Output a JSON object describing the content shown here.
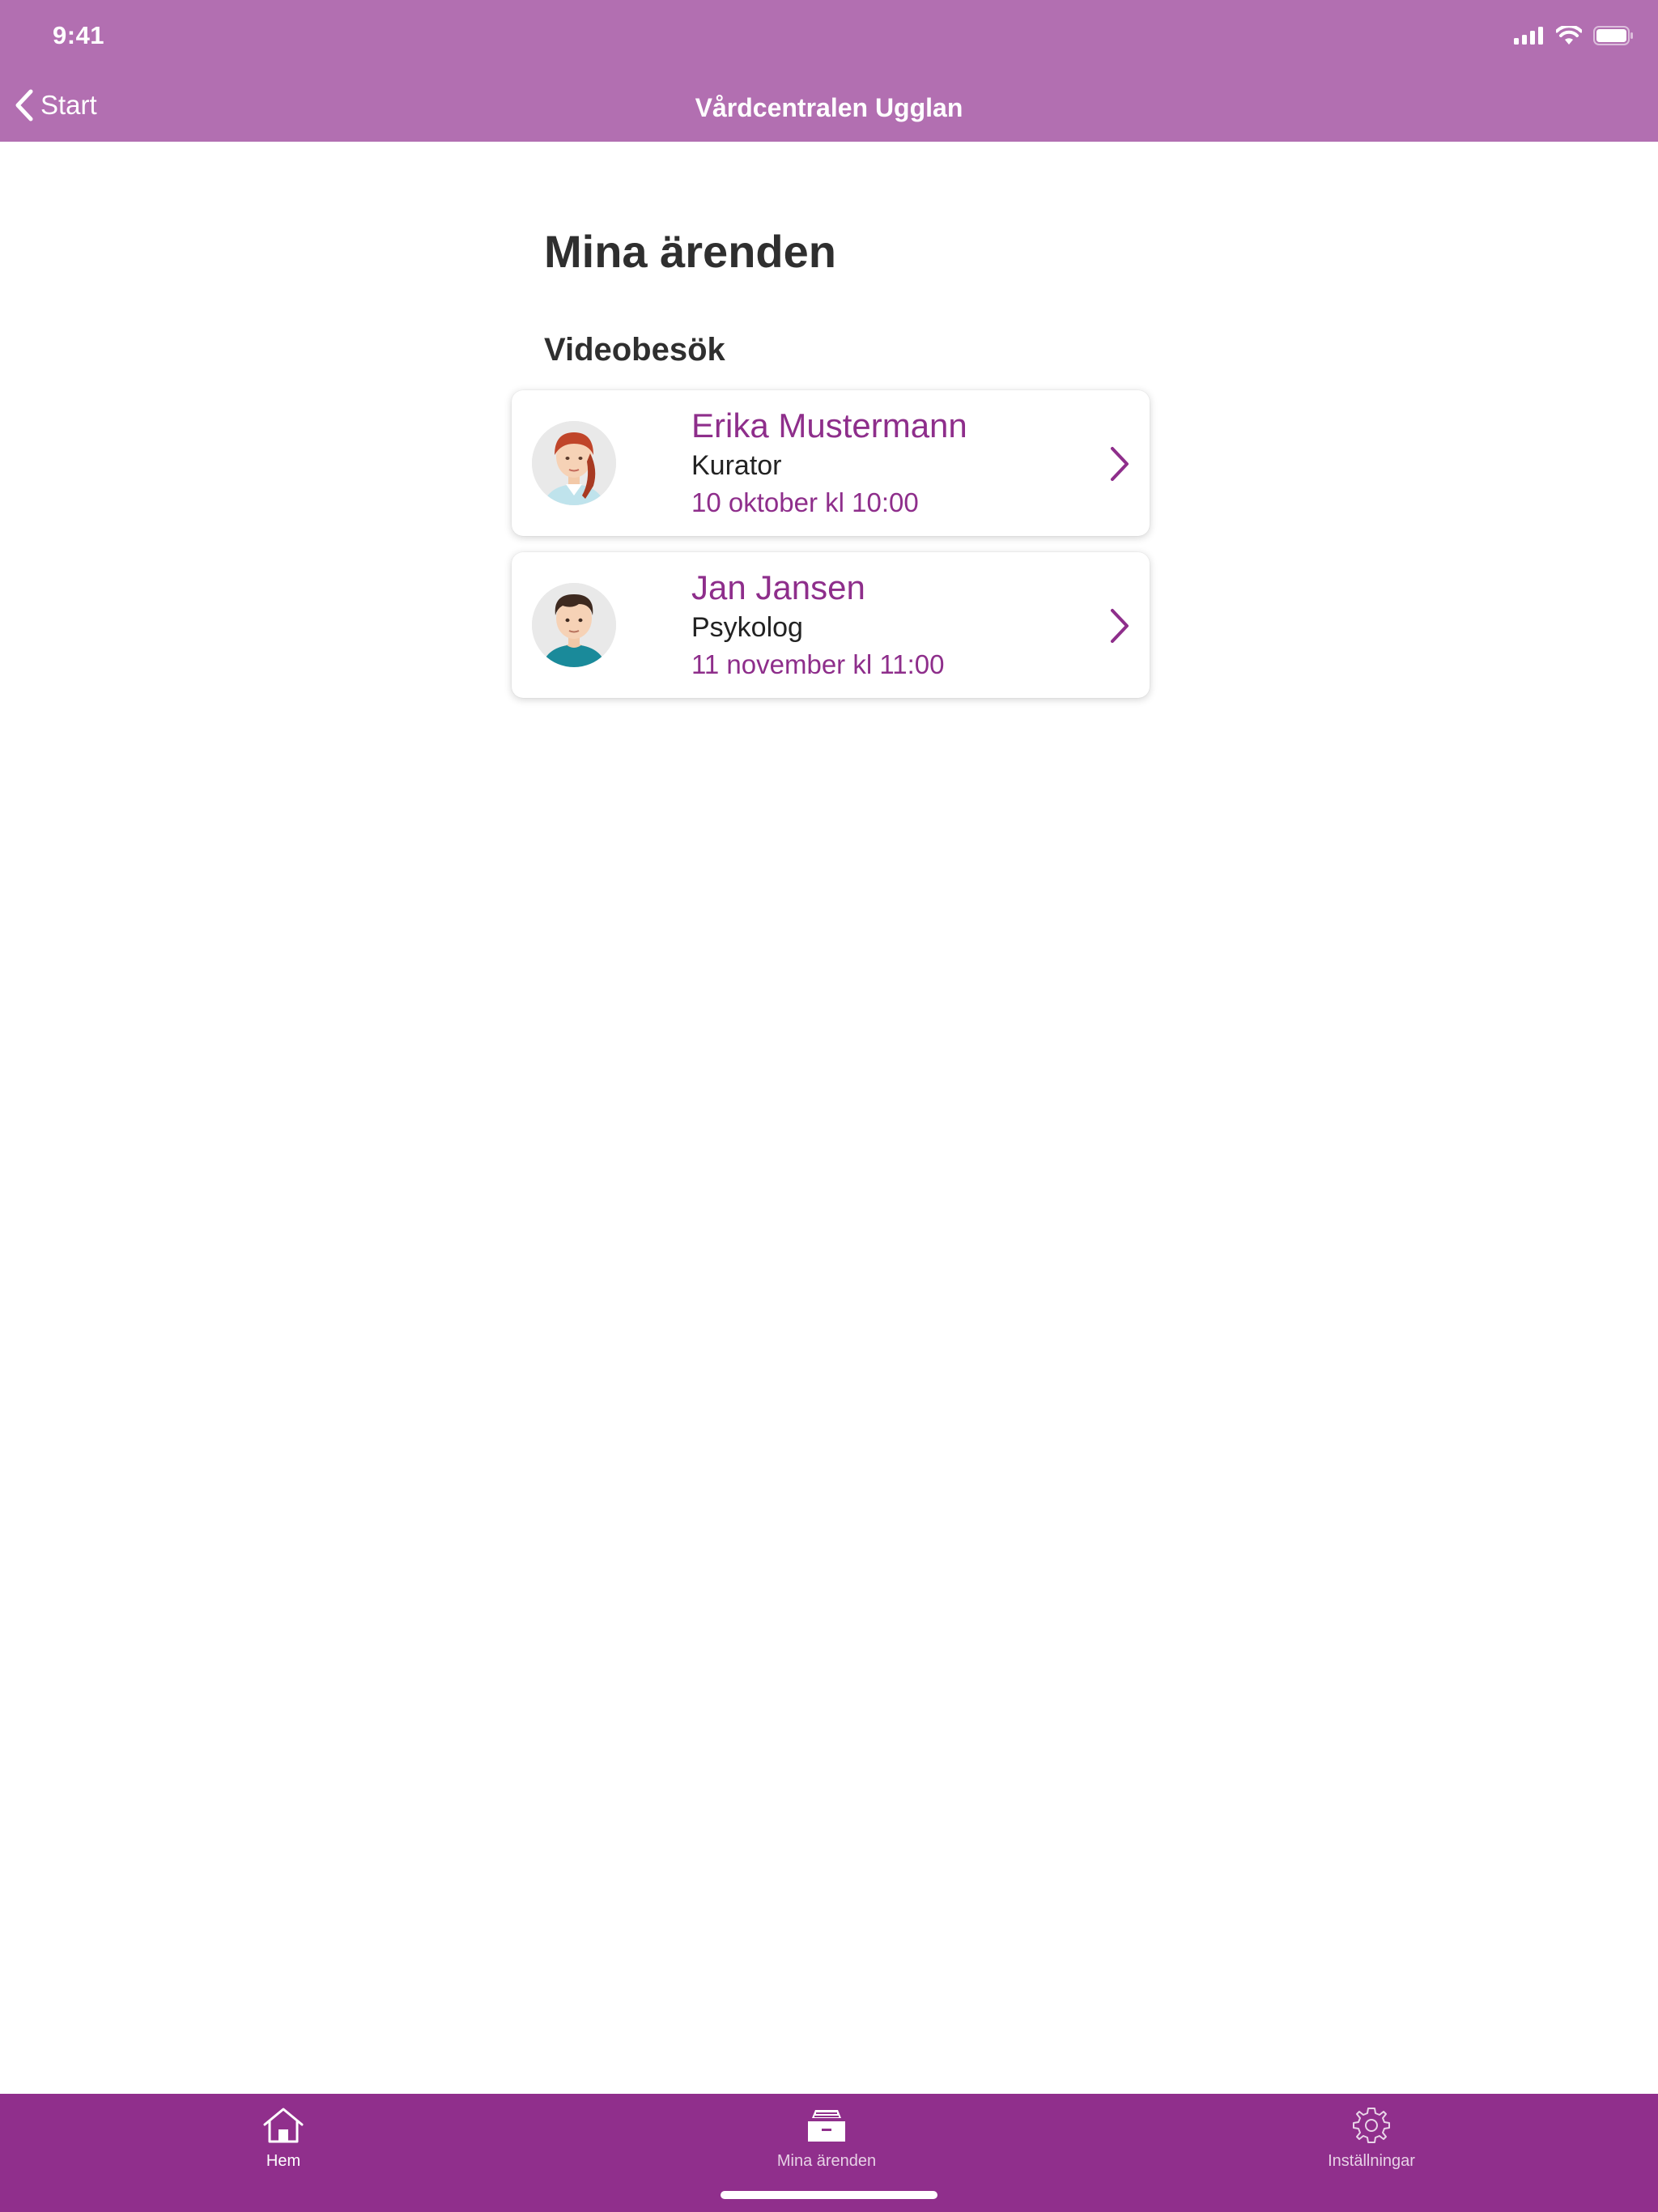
{
  "status_bar": {
    "time": "9:41"
  },
  "nav": {
    "back_label": "Start",
    "title": "Vårdcentralen Ugglan"
  },
  "main": {
    "page_title": "Mina ärenden",
    "section_title": "Videobesök",
    "appointments": [
      {
        "name": "Erika Mustermann",
        "role": "Kurator",
        "time": "10 oktober kl 10:00",
        "avatar_icon": "female-avatar-icon"
      },
      {
        "name": "Jan Jansen",
        "role": "Psykolog",
        "time": "11 november kl 11:00",
        "avatar_icon": "male-avatar-icon"
      }
    ]
  },
  "tabbar": {
    "tabs": [
      {
        "label": "Hem",
        "icon": "home-icon",
        "active": true
      },
      {
        "label": "Mina ärenden",
        "icon": "inbox-tray-icon",
        "active": false
      },
      {
        "label": "Inställningar",
        "icon": "gear-icon",
        "active": false
      }
    ]
  },
  "colors": {
    "header_bg": "#b26fb1",
    "tabbar_bg": "#902f8c",
    "accent": "#8e2e8b",
    "text": "#2f2f2f"
  }
}
